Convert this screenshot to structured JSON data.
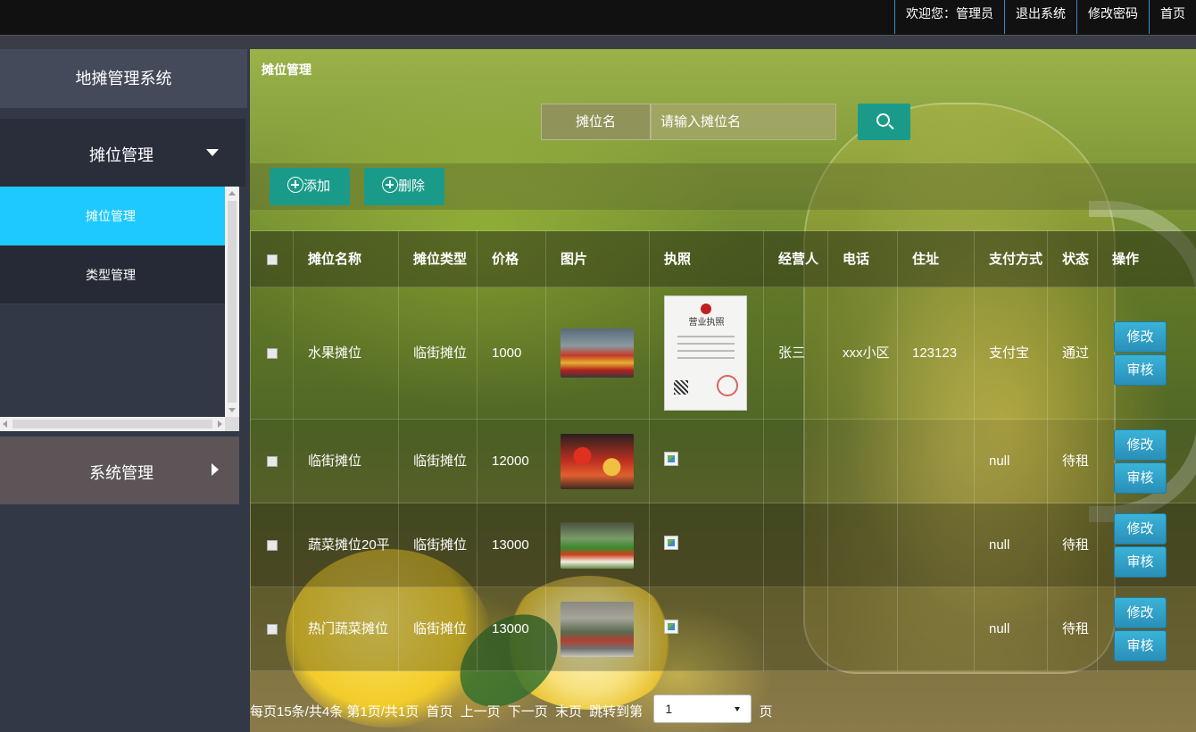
{
  "topnav": {
    "welcome": "欢迎您：管理员",
    "logout": "退出系统",
    "change_password": "修改密码",
    "home": "首页"
  },
  "sidebar": {
    "brand": "地摊管理系统",
    "menus": [
      {
        "label": "摊位管理",
        "expanded": true,
        "items": [
          {
            "label": "摊位管理",
            "active": true
          },
          {
            "label": "类型管理",
            "active": false
          }
        ]
      },
      {
        "label": "系统管理",
        "expanded": false
      }
    ]
  },
  "main": {
    "page_title": "摊位管理",
    "search": {
      "label": "摊位名",
      "placeholder": "请输入摊位名",
      "icon": "search-icon"
    },
    "toolbar": {
      "add": "添加",
      "delete": "删除"
    },
    "table": {
      "headers": [
        "摊位名称",
        "摊位类型",
        "价格",
        "图片",
        "执照",
        "经营人",
        "电话",
        "住址",
        "支付方式",
        "状态",
        "操作"
      ],
      "rows": [
        {
          "name": "水果摊位",
          "type": "临街摊位",
          "price": "1000",
          "image": "fruit-stall-photo",
          "license": "business-license",
          "owner": "张三",
          "phone": "xxx小区",
          "address": "123123",
          "payment": "支付宝",
          "status": "通过"
        },
        {
          "name": "临街摊位",
          "type": "临街摊位",
          "price": "12000",
          "image": "street-stall-photo",
          "license": "broken-image",
          "owner": "",
          "phone": "",
          "address": "",
          "payment": "null",
          "status": "待租"
        },
        {
          "name": "蔬菜摊位20平",
          "type": "临街摊位",
          "price": "13000",
          "image": "vegetable-stall-photo",
          "license": "broken-image",
          "owner": "",
          "phone": "",
          "address": "",
          "payment": "null",
          "status": "待租"
        },
        {
          "name": "热门蔬菜摊位",
          "type": "临街摊位",
          "price": "13000",
          "image": "market-hall-photo",
          "license": "broken-image",
          "owner": "",
          "phone": "",
          "address": "",
          "payment": "null",
          "status": "待租"
        }
      ],
      "actions": {
        "edit": "修改",
        "review": "审核"
      }
    },
    "license_image": {
      "title": "营业执照"
    },
    "pager": {
      "summary": "每页15条/共4条 第1页/共1页",
      "first": "首页",
      "prev": "上一页",
      "next": "下一页",
      "last": "末页",
      "jump_label": "跳转到第",
      "page_value": "1",
      "page_suffix": "页"
    }
  },
  "colors": {
    "accent_cyan": "#1ec9ff",
    "button_teal": "#1a9b8a",
    "action_blue": "#2a9bc8"
  }
}
